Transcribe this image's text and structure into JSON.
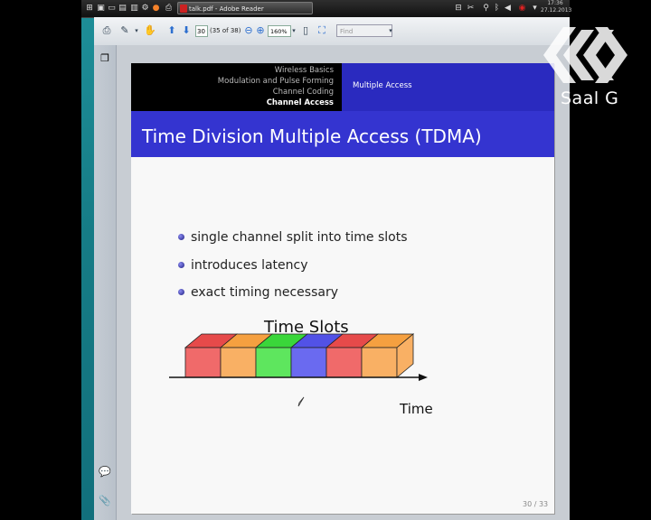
{
  "taskbar": {
    "task_title": "talk.pdf - Adobe Reader",
    "clock_time": "17:36",
    "clock_date": "27.12.2013"
  },
  "toolbar": {
    "page_number": "30",
    "page_count": "(35 of 38)",
    "zoom_level": "160%",
    "find_placeholder": "Find"
  },
  "slide": {
    "nav_items": [
      "Wireless Basics",
      "Modulation and Pulse Forming",
      "Channel Coding",
      "Channel Access"
    ],
    "active_nav_index": 3,
    "section": "Multiple Access",
    "title": "Time Division Multiple Access (TDMA)",
    "bullets": [
      "single channel split into time slots",
      "introduces latency",
      "exact timing necessary"
    ],
    "figure_title": "Time Slots",
    "axis_label": "Time",
    "page_number": "30 / 33",
    "slot_colors": [
      "#f06a6a",
      "#f9b064",
      "#5ee65e",
      "#6a6af0",
      "#f06a6a",
      "#f9b064"
    ],
    "slot_top_colors": [
      "#e64a4a",
      "#f5a040",
      "#3ad63a",
      "#5252e6",
      "#e64a4a",
      "#f5a040"
    ],
    "end_color": "#f9b064"
  },
  "watermark": {
    "text": "Saal G"
  }
}
